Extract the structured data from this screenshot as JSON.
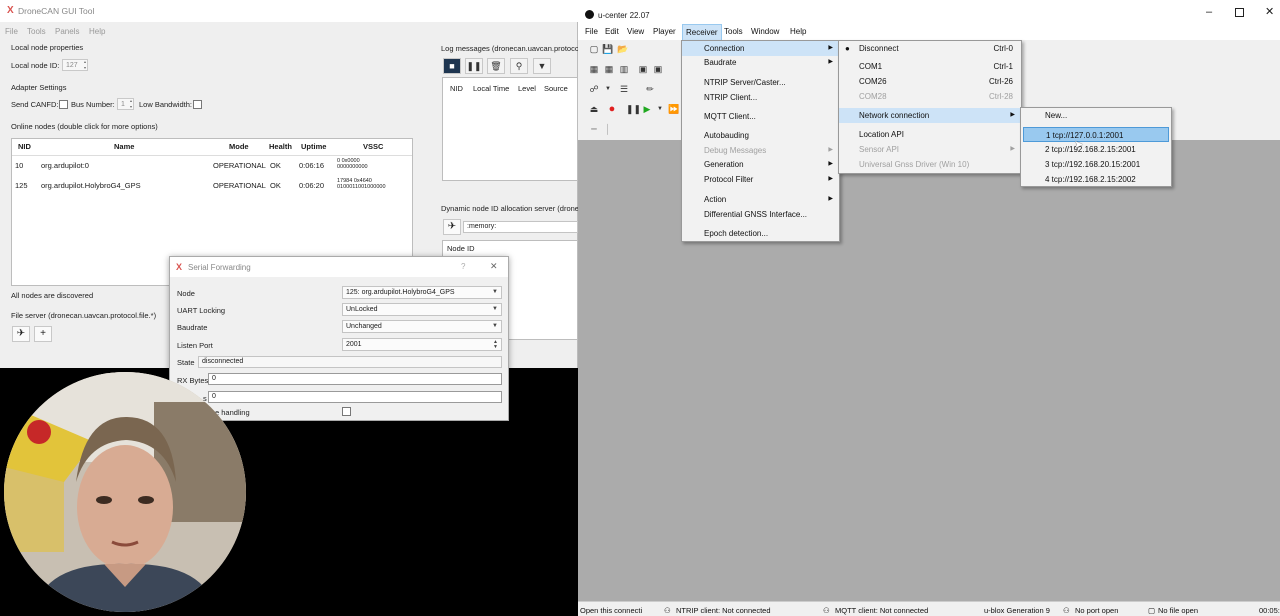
{
  "dronecan": {
    "title": "DroneCAN GUI Tool",
    "menus": [
      "File",
      "Tools",
      "Panels",
      "Help"
    ],
    "local_node_section": "Local node properties",
    "local_node_id_label": "Local node ID:",
    "local_node_id_value": "127",
    "adapter_section": "Adapter Settings",
    "send_canfd_label": "Send CANFD:",
    "bus_number_label": "Bus Number:",
    "bus_number_value": "1",
    "low_bandwidth_label": "Low Bandwidth:",
    "online_nodes_label": "Online nodes (double click for more options)",
    "node_columns": [
      "NID",
      "Name",
      "Mode",
      "Health",
      "Uptime",
      "VSSC"
    ],
    "nodes": [
      {
        "nid": "10",
        "name": "org.ardupilot:0",
        "mode": "OPERATIONAL",
        "health": "OK",
        "uptime": "0:06:16",
        "vssc_line1": "0           0x0000",
        "vssc_line2": "0000000000"
      },
      {
        "nid": "125",
        "name": "org.ardupilot.HolybroG4_GPS",
        "mode": "OPERATIONAL",
        "health": "OK",
        "uptime": "0:06:20",
        "vssc_line1": "17984     0x4640",
        "vssc_line2": "0100011001000000"
      }
    ],
    "all_nodes_text": "All nodes are discovered",
    "file_server_label": "File server (dronecan.uavcan.protocol.file.*)",
    "log_label": "Log messages (dronecan.uavcan.protocol.",
    "log_columns": [
      "NID",
      "Local Time",
      "Level",
      "Source"
    ],
    "dna_label": "Dynamic node ID allocation server (dronec",
    "dna_db": ":memory:",
    "dna_column": "Node ID"
  },
  "serial_forwarding": {
    "title": "Serial Forwarding",
    "help": "?",
    "close": "✕",
    "node_label": "Node",
    "node_value": "125: org.ardupilot.HolybroG4_GPS",
    "uart_label": "UART Locking",
    "uart_value": "UnLocked",
    "baud_label": "Baudrate",
    "baud_value": "Unchanged",
    "port_label": "Listen Port",
    "port_value": "2001",
    "state_label": "State",
    "state_value": "disconnected",
    "rx_label": "RX Bytes",
    "rx_value": "0",
    "tx_label": "s",
    "tx_value": "0",
    "handling_label": "e handling"
  },
  "ucenter": {
    "title": "u-center 22.07",
    "menus": [
      "File",
      "Edit",
      "View",
      "Player",
      "Receiver",
      "Tools",
      "Window",
      "Help"
    ],
    "receiver_menu": [
      {
        "label": "Connection",
        "arrow": true
      },
      {
        "label": "Baudrate",
        "arrow": true
      },
      {
        "label": "NTRIP Server/Caster..."
      },
      {
        "label": "NTRIP Client..."
      },
      {
        "label": "MQTT Client..."
      },
      {
        "label": "Autobauding"
      },
      {
        "label": "Debug Messages",
        "disabled": true,
        "arrow": true
      },
      {
        "label": "Generation",
        "arrow": true
      },
      {
        "label": "Protocol Filter",
        "arrow": true
      },
      {
        "label": "Action",
        "arrow": true
      },
      {
        "label": "Differential GNSS Interface..."
      },
      {
        "label": "Epoch detection..."
      }
    ],
    "connection_menu": [
      {
        "label": "Disconnect",
        "shortcut": "Ctrl-0"
      },
      {
        "label": "COM1",
        "shortcut": "Ctrl-1"
      },
      {
        "label": "COM26",
        "shortcut": "Ctrl-26"
      },
      {
        "label": "COM28",
        "shortcut": "Ctrl-28",
        "disabled": true
      },
      {
        "label": "Network connection",
        "arrow": true
      },
      {
        "label": "Location API"
      },
      {
        "label": "Sensor API",
        "disabled": true,
        "arrow": true
      },
      {
        "label": "Universal Gnss Driver (Win 10)",
        "disabled": true
      }
    ],
    "network_menu": [
      "New...",
      "1 tcp://127.0.0.1:2001",
      "2 tcp://192.168.2.15:2001",
      "3 tcp://192.168.20.15:2001",
      "4 tcp://192.168.2.15:2002"
    ],
    "status": [
      "Open this connecti",
      "NTRIP client: Not connected",
      "MQTT client: Not connected",
      "u-blox Generation 9",
      "No port open",
      "No file open",
      "00:05:"
    ]
  },
  "colors": {
    "highlight": "#99c9ef",
    "hover": "#cde3f7",
    "record_red": "#e02020",
    "play_green": "#1fa81f"
  }
}
